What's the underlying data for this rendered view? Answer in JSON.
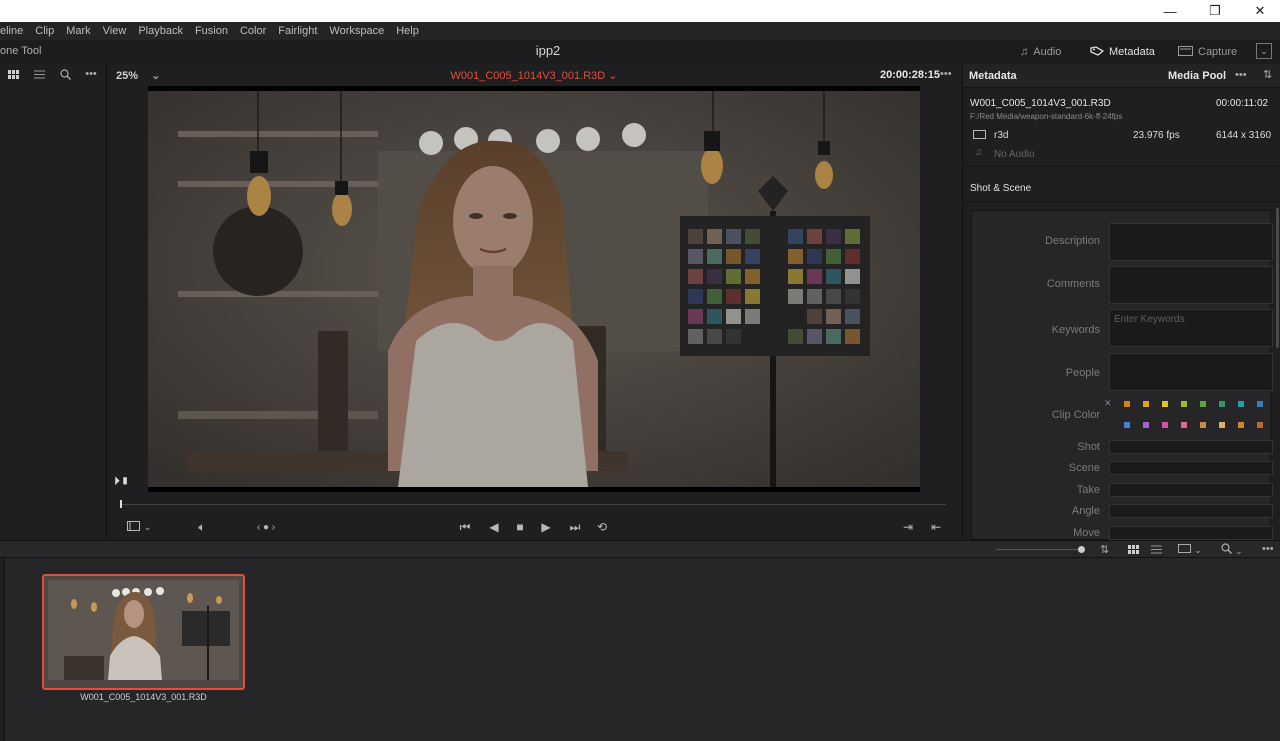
{
  "window": {
    "minimize_glyph": "—",
    "restore_glyph": "❐",
    "close_glyph": "✕"
  },
  "menu": [
    "eline",
    "Clip",
    "Mark",
    "View",
    "Playback",
    "Fusion",
    "Color",
    "Fairlight",
    "Workspace",
    "Help"
  ],
  "header": {
    "tool_label": "one Tool",
    "project_title": "ipp2",
    "audio_label": "Audio",
    "metadata_label": "Metadata",
    "capture_label": "Capture"
  },
  "viewer": {
    "zoom": "25%",
    "clip_name": "W001_C005_1014V3_001.R3D",
    "timecode": "20:00:28:15"
  },
  "metadata_panel": {
    "title": "Metadata",
    "source_tab": "Media Pool",
    "clip_name": "W001_C005_1014V3_001.R3D",
    "duration": "00:00:11:02",
    "path": "F:/Red Media/weapon-standard-6k-ff-24fps",
    "codec": "r3d",
    "fps": "23.976 fps",
    "resolution": "6144 x 3160",
    "audio": "No Audio",
    "section": "Shot & Scene",
    "fields": {
      "description": "Description",
      "comments": "Comments",
      "keywords": "Keywords",
      "keywords_placeholder": "Enter Keywords",
      "people": "People",
      "clip_color": "Clip Color",
      "shot": "Shot",
      "scene": "Scene",
      "take": "Take",
      "angle": "Angle",
      "move": "Move"
    },
    "clip_colors_row1": [
      "#d9820f",
      "#e6a01a",
      "#e5c31b",
      "#9cbd2a",
      "#5aa636",
      "#2f9a6a",
      "#1f9fa8",
      "#2e7fc4"
    ],
    "clip_colors_row2": [
      "#4a7ed1",
      "#a564c9",
      "#d253a8",
      "#e06a8c",
      "#c98d4b",
      "#d8b072",
      "#c98a2e",
      "#b86b2a"
    ]
  },
  "media_pool": {
    "clip_name": "W001_C005_1014V3_001.R3D"
  },
  "colors": {
    "accent_red": "#e0503a",
    "background": "#1f1f21"
  }
}
